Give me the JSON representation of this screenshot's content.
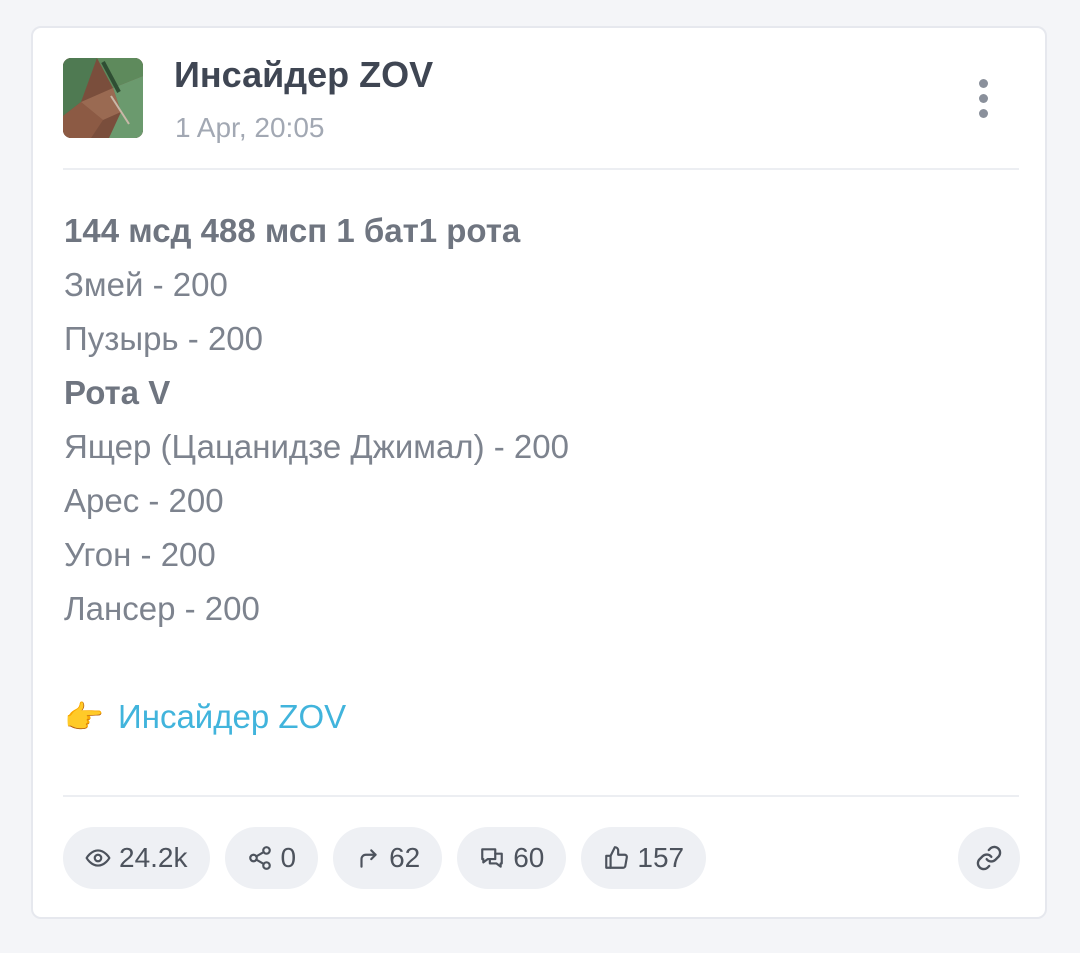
{
  "post": {
    "channel_name": "Инсайдер ZOV",
    "date": "1 Apr, 20:05",
    "lines": [
      "144 мсд 488 мсп 1 бат1 рота",
      "Змей - 200",
      "Пузырь - 200",
      "Рота V",
      "Ящер (Цацанидзе Джимал) - 200",
      "Арес - 200",
      "Угон - 200",
      "Лансер - 200"
    ],
    "link_emoji": "👉",
    "link_text": "Инсайдер ZOV"
  },
  "stats": {
    "views": "24.2k",
    "shares": "0",
    "forwards": "62",
    "comments": "60",
    "likes": "157"
  },
  "icons": {
    "menu": "more-vertical-icon",
    "views": "eye-icon",
    "shares": "share-icon",
    "forwards": "forward-arrow-icon",
    "comments": "comments-icon",
    "likes": "thumbs-up-icon",
    "link": "link-icon"
  },
  "colors": {
    "link": "#41b4dc",
    "text": "#7d838e",
    "title": "#3f4653"
  }
}
